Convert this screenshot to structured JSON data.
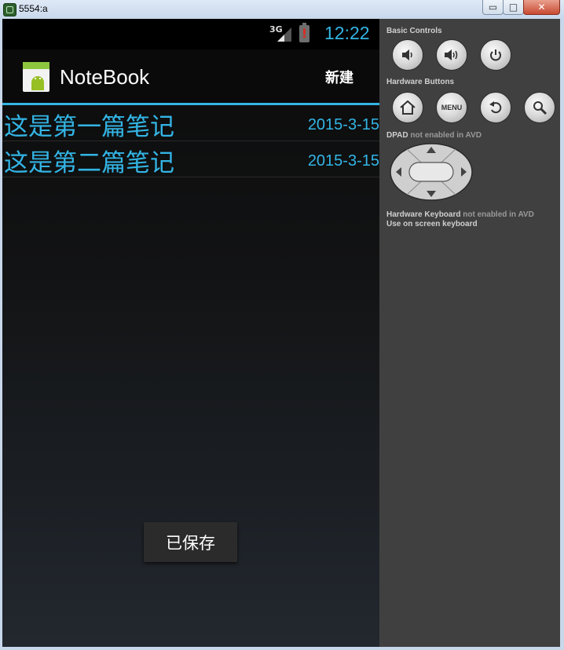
{
  "window": {
    "title": "5554:a",
    "minimize_label": "▭",
    "maximize_label": "□",
    "close_label": "✕"
  },
  "status_bar": {
    "network": "3G",
    "time": "12:22"
  },
  "action_bar": {
    "app_title": "NoteBook",
    "new_button": "新建"
  },
  "notes": [
    {
      "title": "这是第一篇笔记",
      "date": "2015-3-15"
    },
    {
      "title": "这是第二篇笔记",
      "date": "2015-3-15"
    }
  ],
  "toast": {
    "message": "已保存"
  },
  "controls_panel": {
    "basic_controls_label": "Basic Controls",
    "hardware_buttons_label": "Hardware Buttons",
    "menu_button_label": "MENU",
    "dpad_label": "DPAD",
    "dpad_status": "not enabled in AVD",
    "keyboard_label": "Hardware Keyboard",
    "keyboard_status": "not enabled in AVD",
    "onscreen_keyboard_text": "Use on screen keyboard"
  },
  "colors": {
    "accent": "#33b5e5",
    "panel_bg": "#404040",
    "phone_bg": "#0b0b0b"
  },
  "icons": {
    "volume_down": "volume-down-icon",
    "volume_up": "volume-up-icon",
    "power": "power-icon",
    "home": "home-icon",
    "back": "back-icon",
    "search": "search-icon"
  }
}
